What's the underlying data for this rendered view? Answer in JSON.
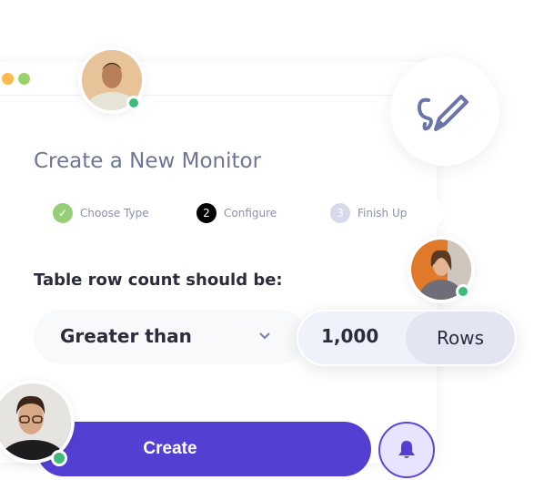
{
  "window": {
    "dots": [
      {
        "color": "#ffb94a"
      },
      {
        "color": "#98d26a"
      }
    ]
  },
  "title": "Create a New Monitor",
  "steps": [
    {
      "label": "Choose Type",
      "status": "done",
      "badge": "✓",
      "color": "#97cf79"
    },
    {
      "label": "Configure",
      "status": "active",
      "badge": "2",
      "color": "#000000"
    },
    {
      "label": "Finish Up",
      "status": "pending",
      "badge": "3",
      "color": "#d6d9ea"
    }
  ],
  "condition": {
    "label": "Table row count should be:",
    "operator": "Greater than",
    "value": "1,000",
    "unit": "Rows"
  },
  "create_button": "Create",
  "colors": {
    "accent": "#5340d2",
    "online": "#3dbb7a",
    "muted_text": "#6e7596"
  },
  "icons": {
    "edit": "pen-squiggle-icon",
    "notify": "bell-icon",
    "dropdown": "chevron-down-icon"
  }
}
